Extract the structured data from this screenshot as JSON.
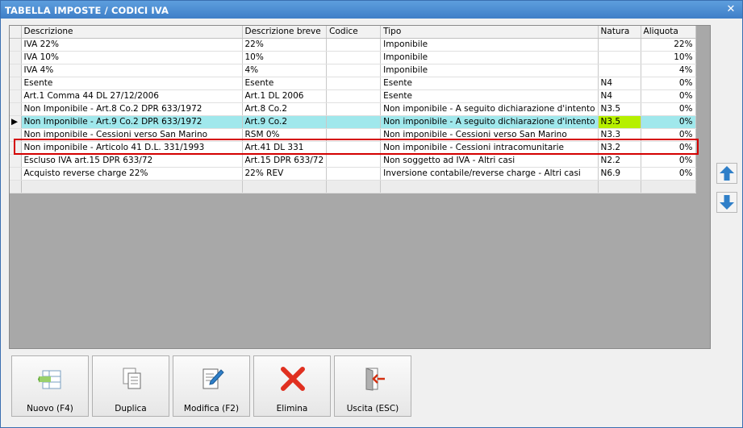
{
  "window": {
    "title": "TABELLA IMPOSTE / CODICI IVA",
    "close_glyph": "✕"
  },
  "grid": {
    "columns": [
      "Descrizione",
      "Descrizione breve",
      "Codice",
      "Tipo",
      "Natura",
      "Aliquota"
    ],
    "rows": [
      {
        "descrizione": "IVA 22%",
        "breve": "22%",
        "codice": "",
        "tipo": "Imponibile",
        "natura": "",
        "aliquota": "22%"
      },
      {
        "descrizione": "IVA 10%",
        "breve": "10%",
        "codice": "",
        "tipo": "Imponibile",
        "natura": "",
        "aliquota": "10%"
      },
      {
        "descrizione": "IVA 4%",
        "breve": "4%",
        "codice": "",
        "tipo": "Imponibile",
        "natura": "",
        "aliquota": "4%"
      },
      {
        "descrizione": "Esente",
        "breve": "Esente",
        "codice": "",
        "tipo": "Esente",
        "natura": "N4",
        "aliquota": "0%"
      },
      {
        "descrizione": "Art.1 Comma 44 DL 27/12/2006",
        "breve": "Art.1 DL 2006",
        "codice": "",
        "tipo": "Esente",
        "natura": "N4",
        "aliquota": "0%"
      },
      {
        "descrizione": "Non Imponibile - Art.8 Co.2 DPR 633/1972",
        "breve": "Art.8 Co.2",
        "codice": "",
        "tipo": "Non imponibile - A seguito dichiarazione d'intento",
        "natura": "N3.5",
        "aliquota": "0%"
      },
      {
        "descrizione": "Non Imponibile - Art.9 Co.2 DPR 633/1972",
        "breve": "Art.9 Co.2",
        "codice": "",
        "tipo": "Non imponibile - A seguito dichiarazione d'intento",
        "natura": "N3.5",
        "aliquota": "0%",
        "selected": true
      },
      {
        "descrizione": "Non imponibile - Cessioni verso San Marino",
        "breve": "RSM 0%",
        "codice": "",
        "tipo": "Non imponibile - Cessioni verso San Marino",
        "natura": "N3.3",
        "aliquota": "0%"
      },
      {
        "descrizione": "Non imponibile - Articolo 41 D.L. 331/1993",
        "breve": "Art.41 DL 331",
        "codice": "",
        "tipo": "Non imponibile - Cessioni intracomunitarie",
        "natura": "N3.2",
        "aliquota": "0%"
      },
      {
        "descrizione": "Escluso IVA art.15 DPR 633/72",
        "breve": "Art.15 DPR 633/72",
        "codice": "",
        "tipo": "Non soggetto ad IVA - Altri casi",
        "natura": "N2.2",
        "aliquota": "0%"
      },
      {
        "descrizione": "Acquisto reverse charge 22%",
        "breve": "22% REV",
        "codice": "",
        "tipo": "Inversione contabile/reverse charge - Altri casi",
        "natura": "N6.9",
        "aliquota": "0%"
      }
    ],
    "selected_indicator": "▶"
  },
  "side": {
    "up_icon": "arrow-up-icon",
    "down_icon": "arrow-down-icon",
    "arrow_color": "#2f7fc8"
  },
  "toolbar": {
    "nuovo": "Nuovo (F4)",
    "duplica": "Duplica",
    "modifica": "Modifica (F2)",
    "elimina": "Elimina",
    "uscita": "Uscita (ESC)"
  },
  "colors": {
    "selected_row": "#a0e8ec",
    "natura_highlight": "#b6f000",
    "annotation_box": "#d40000",
    "delete_icon": "#e03020"
  }
}
